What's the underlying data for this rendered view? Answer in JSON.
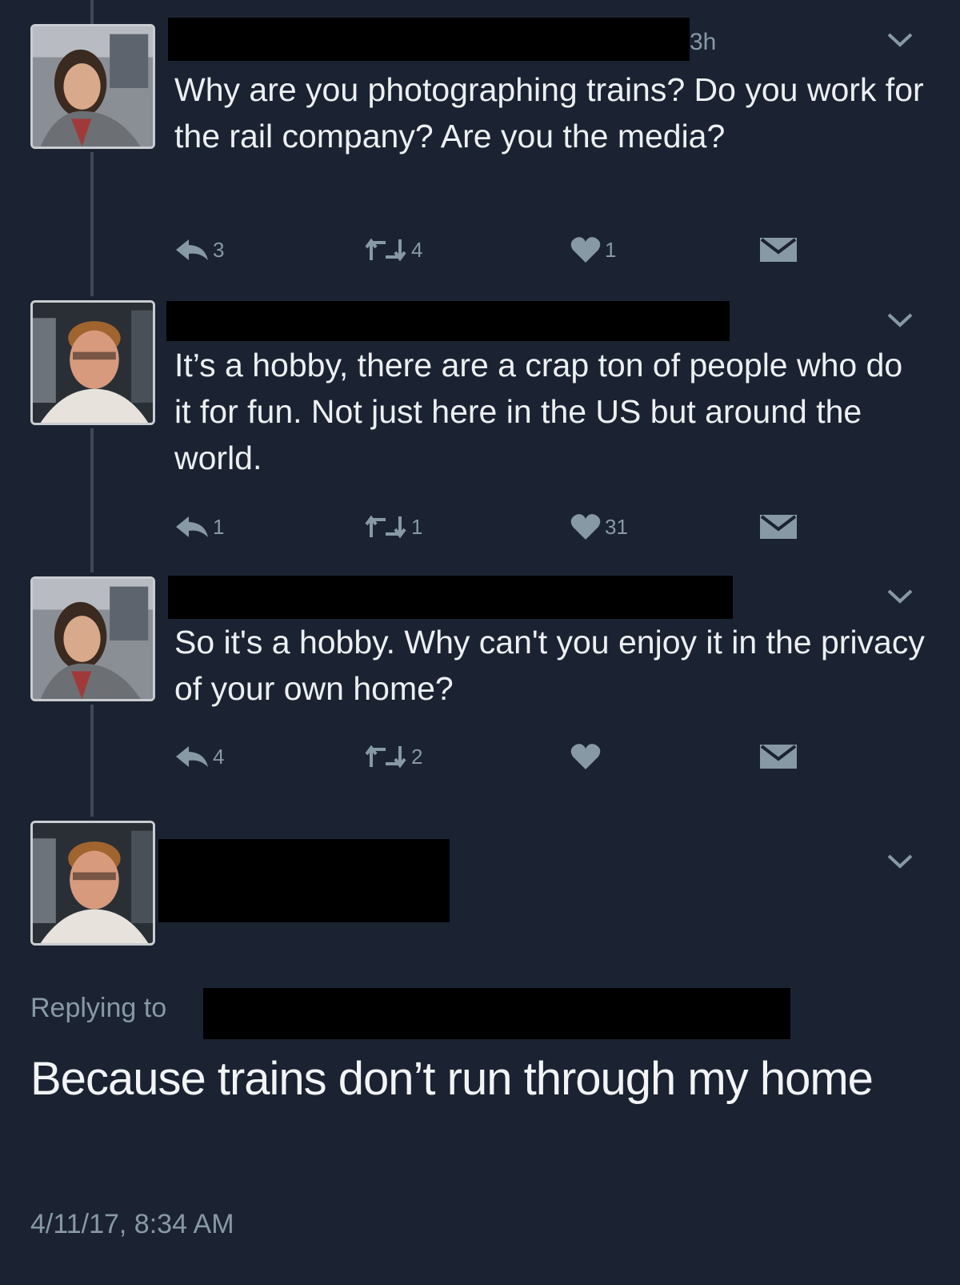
{
  "colors": {
    "background": "#1b2332",
    "secondary_text": "#8899a6",
    "primary_text": "#edf0f3",
    "thread_line": "#3d4859",
    "redaction": "#000000"
  },
  "tweets": [
    {
      "time": "3h",
      "text": "Why are you photographing trains? Do you work for the rail company? Are you the media?",
      "actions": {
        "reply": "3",
        "retweet": "4",
        "like": "1"
      }
    },
    {
      "text": "It’s a hobby, there are a crap ton of people who do it for fun. Not just here in the US but around the world.",
      "actions": {
        "reply": "1",
        "retweet": "1",
        "like": "31"
      }
    },
    {
      "text": "So it's a hobby. Why can't you enjoy it in the privacy of your own home?",
      "actions": {
        "reply": "4",
        "retweet": "2",
        "like": ""
      }
    }
  ],
  "focused_tweet": {
    "replying_label": "Replying to",
    "text": "Because trains don’t run through my home",
    "timestamp": "4/11/17, 8:34 AM"
  },
  "icons": [
    "reply-icon",
    "retweet-icon",
    "like-icon",
    "message-icon",
    "chevron-down-icon"
  ]
}
